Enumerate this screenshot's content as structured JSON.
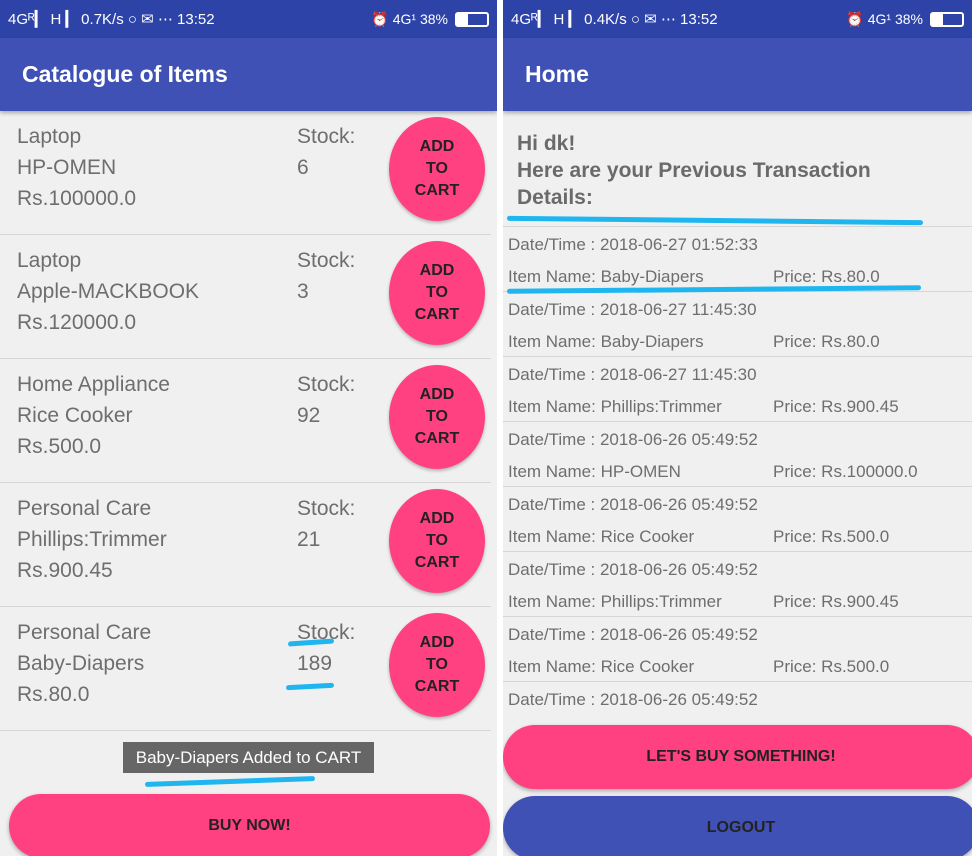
{
  "left": {
    "status_bar": {
      "left": "4Gᴿ▎ H ▎ 0.7K/s ○ ✉ ⋯ 13:52",
      "right": "⏰ 4G¹ 38%",
      "battery": 0.38
    },
    "app_bar_title": "Catalogue of Items",
    "items": [
      {
        "category": "Laptop",
        "name": "HP-OMEN",
        "price": "Rs.100000.0",
        "stock_label": "Stock:",
        "stock": "6",
        "button": "ADD\nTO\nCART"
      },
      {
        "category": "Laptop",
        "name": "Apple-MACKBOOK",
        "price": "Rs.120000.0",
        "stock_label": "Stock:",
        "stock": "3",
        "button": "ADD\nTO\nCART"
      },
      {
        "category": "Home Appliance",
        "name": "Rice Cooker",
        "price": "Rs.500.0",
        "stock_label": "Stock:",
        "stock": "92",
        "button": "ADD\nTO\nCART"
      },
      {
        "category": "Personal Care",
        "name": "Phillips:Trimmer",
        "price": "Rs.900.45",
        "stock_label": "Stock:",
        "stock": "21",
        "button": "ADD\nTO\nCART"
      },
      {
        "category": "Personal Care",
        "name": "Baby-Diapers",
        "price": "Rs.80.0",
        "stock_label": "Stock:",
        "stock": "189",
        "button": "ADD\nTO\nCART"
      }
    ],
    "toast": "Baby-Diapers Added to CART",
    "buy_button": "BUY NOW!"
  },
  "right": {
    "status_bar": {
      "left": "4Gᴿ▎ H ▎ 0.4K/s ○ ✉ ⋯ 13:52",
      "right": "⏰ 4G¹ 38%",
      "battery": 0.38
    },
    "app_bar_title": "Home",
    "greeting_line1": "Hi dk!",
    "greeting_line2": "Here are your Previous Transaction",
    "greeting_line3": "Details:",
    "transactions": [
      {
        "datetime": "Date/Time : 2018-06-27 01:52:33",
        "item": "Item Name: Baby-Diapers",
        "price": "Price: Rs.80.0"
      },
      {
        "datetime": "Date/Time : 2018-06-27 11:45:30",
        "item": "Item Name: Baby-Diapers",
        "price": "Price: Rs.80.0"
      },
      {
        "datetime": "Date/Time : 2018-06-27 11:45:30",
        "item": "Item Name: Phillips:Trimmer",
        "price": "Price: Rs.900.45"
      },
      {
        "datetime": "Date/Time : 2018-06-26 05:49:52",
        "item": "Item Name: HP-OMEN",
        "price": "Price: Rs.100000.0"
      },
      {
        "datetime": "Date/Time : 2018-06-26 05:49:52",
        "item": "Item Name: Rice Cooker",
        "price": "Price: Rs.500.0"
      },
      {
        "datetime": "Date/Time : 2018-06-26 05:49:52",
        "item": "Item Name: Phillips:Trimmer",
        "price": "Price: Rs.900.45"
      },
      {
        "datetime": "Date/Time : 2018-06-26 05:49:52",
        "item": "Item Name: Rice Cooker",
        "price": "Price: Rs.500.0"
      },
      {
        "datetime": "Date/Time : 2018-06-26 05:49:52",
        "item": "",
        "price": ""
      }
    ],
    "buy_button": "LET'S BUY SOMETHING!",
    "logout_button": "LOGOUT"
  },
  "colors": {
    "app_bar": "#3f51b5",
    "status_bar": "#2e43a8",
    "accent": "#ff4081",
    "highlight": "#1fb6f0"
  }
}
